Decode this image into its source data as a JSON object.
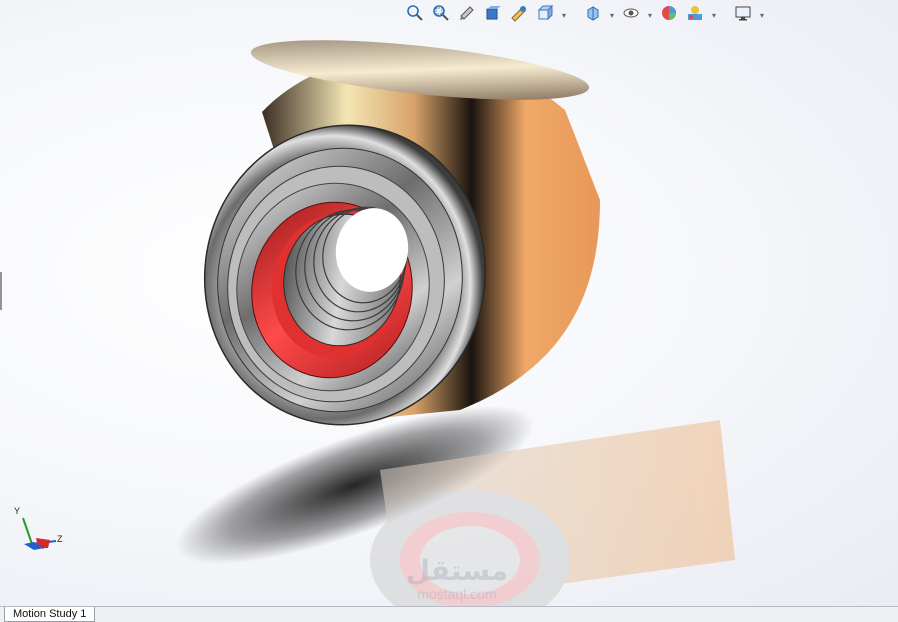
{
  "toolbar": {
    "items": [
      {
        "icon": "zoom-to-fit-icon"
      },
      {
        "icon": "zoom-to-area-icon"
      },
      {
        "icon": "previous-view-icon"
      },
      {
        "icon": "section-view-icon"
      },
      {
        "icon": "dynamic-annotation-icon"
      },
      {
        "icon": "view-orientation-icon",
        "dropdown": true
      },
      {
        "icon": "display-style-icon",
        "dropdown": true
      },
      {
        "icon": "hide-show-items-icon",
        "dropdown": true
      },
      {
        "icon": "edit-appearance-icon"
      },
      {
        "icon": "apply-scene-icon",
        "dropdown": true
      },
      {
        "icon": "view-settings-icon",
        "dropdown": true
      }
    ]
  },
  "triad": {
    "y_label": "Y",
    "z_label": "Z"
  },
  "watermark": {
    "arabic": "مستقل",
    "url": "mostaql.com"
  },
  "bottom_tabs": [
    {
      "label": "Motion Study 1"
    }
  ],
  "colors": {
    "copper": "#e8a060",
    "red_seal": "#d82828",
    "steel": "#8a8a8a",
    "background": "#f3f5f9"
  }
}
